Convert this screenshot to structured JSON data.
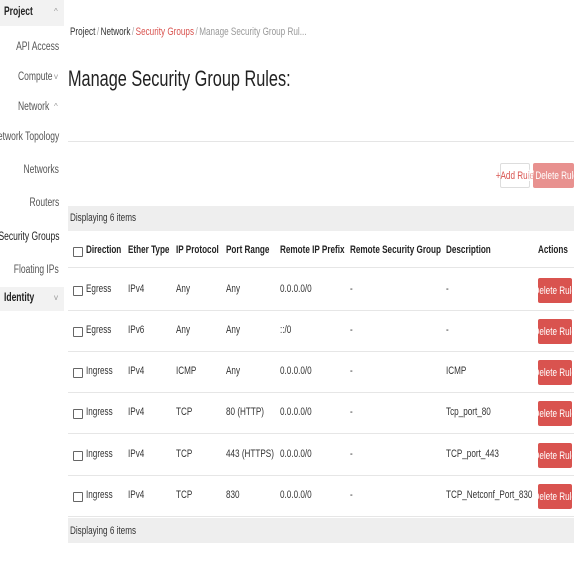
{
  "sidebar": {
    "project_label": "Project",
    "items": {
      "api_access": "API Access",
      "compute": "Compute",
      "network": "Network",
      "network_topology": "Network Topology",
      "networks": "Networks",
      "routers": "Routers",
      "security_groups": "Security Groups",
      "floating_ips": "Floating IPs",
      "identity": "Identity"
    }
  },
  "breadcrumb": {
    "project": "Project",
    "network": "Network",
    "security_groups": "Security Groups",
    "current": "Manage Security Group Rul..."
  },
  "page_title": "Manage Security Group Rules:",
  "actions": {
    "add_rule": "Add Rule",
    "delete_rules": "Delete Rules"
  },
  "table": {
    "count_text": "Displaying 6 items",
    "columns": {
      "direction": "Direction",
      "ether_type": "Ether Type",
      "ip_protocol": "IP Protocol",
      "port_range": "Port Range",
      "remote_ip_prefix": "Remote IP Prefix",
      "remote_security_group": "Remote Security Group",
      "description": "Description",
      "actions": "Actions"
    },
    "rows": [
      {
        "direction": "Egress",
        "ether_type": "IPv4",
        "ip_protocol": "Any",
        "port_range": "Any",
        "remote_ip_prefix": "0.0.0.0/0",
        "remote_security_group": "-",
        "description": "-",
        "action": "Delete Rule"
      },
      {
        "direction": "Egress",
        "ether_type": "IPv6",
        "ip_protocol": "Any",
        "port_range": "Any",
        "remote_ip_prefix": "::/0",
        "remote_security_group": "-",
        "description": "-",
        "action": "Delete Rule"
      },
      {
        "direction": "Ingress",
        "ether_type": "IPv4",
        "ip_protocol": "ICMP",
        "port_range": "Any",
        "remote_ip_prefix": "0.0.0.0/0",
        "remote_security_group": "-",
        "description": "ICMP",
        "action": "Delete Rule"
      },
      {
        "direction": "Ingress",
        "ether_type": "IPv4",
        "ip_protocol": "TCP",
        "port_range": "80 (HTTP)",
        "remote_ip_prefix": "0.0.0.0/0",
        "remote_security_group": "-",
        "description": "Tcp_port_80",
        "action": "Delete Rule"
      },
      {
        "direction": "Ingress",
        "ether_type": "IPv4",
        "ip_protocol": "TCP",
        "port_range": "443 (HTTPS)",
        "remote_ip_prefix": "0.0.0.0/0",
        "remote_security_group": "-",
        "description": "TCP_port_443",
        "action": "Delete Rule"
      },
      {
        "direction": "Ingress",
        "ether_type": "IPv4",
        "ip_protocol": "TCP",
        "port_range": "830",
        "remote_ip_prefix": "0.0.0.0/0",
        "remote_security_group": "-",
        "description": "TCP_Netconf_Port_830",
        "action": "Delete Rule"
      }
    ]
  },
  "colors": {
    "accent_red": "#d9534f",
    "disabled_red": "#e8918f"
  },
  "icons": {
    "add": "plus-icon",
    "delete": "trash-icon",
    "expand": "chevron-icon"
  }
}
